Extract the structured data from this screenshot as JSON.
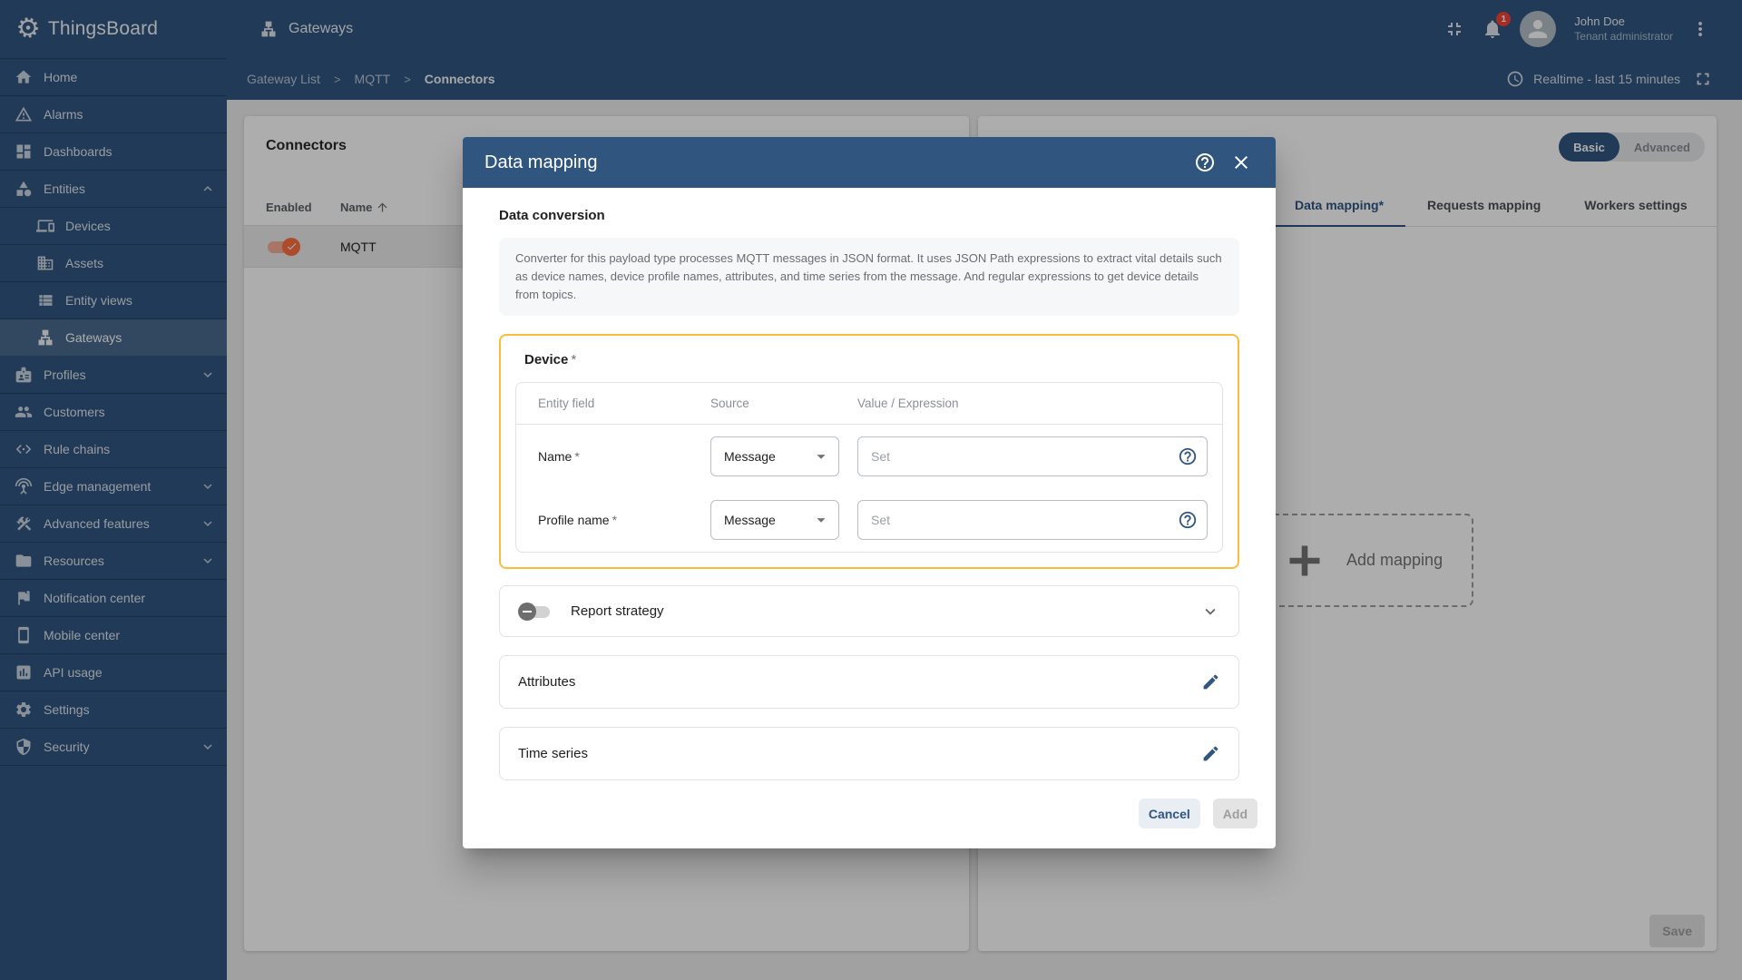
{
  "app": {
    "name": "ThingsBoard"
  },
  "topbar": {
    "title": "Gateways",
    "notifications_badge": "1",
    "user": {
      "name": "John Doe",
      "role": "Tenant administrator"
    }
  },
  "breadcrumb": {
    "items": [
      "Gateway List",
      "MQTT",
      "Connectors"
    ],
    "separator": ">"
  },
  "timewindow": {
    "label": "Realtime - last 15 minutes"
  },
  "sidebar": {
    "items": [
      {
        "label": "Home",
        "icon": "home"
      },
      {
        "label": "Alarms",
        "icon": "alarms"
      },
      {
        "label": "Dashboards",
        "icon": "dashboards"
      },
      {
        "label": "Entities",
        "icon": "entities",
        "expanded": true
      },
      {
        "label": "Devices",
        "icon": "devices",
        "child": true
      },
      {
        "label": "Assets",
        "icon": "assets",
        "child": true
      },
      {
        "label": "Entity views",
        "icon": "entity-views",
        "child": true
      },
      {
        "label": "Gateways",
        "icon": "gateways",
        "child": true,
        "active": true
      },
      {
        "label": "Profiles",
        "icon": "profiles",
        "expandable": true
      },
      {
        "label": "Customers",
        "icon": "customers"
      },
      {
        "label": "Rule chains",
        "icon": "rule-chains"
      },
      {
        "label": "Edge management",
        "icon": "edge",
        "expandable": true
      },
      {
        "label": "Advanced features",
        "icon": "advanced",
        "expandable": true
      },
      {
        "label": "Resources",
        "icon": "resources",
        "expandable": true
      },
      {
        "label": "Notification center",
        "icon": "notification"
      },
      {
        "label": "Mobile center",
        "icon": "mobile"
      },
      {
        "label": "API usage",
        "icon": "api"
      },
      {
        "label": "Settings",
        "icon": "settings"
      },
      {
        "label": "Security",
        "icon": "security",
        "expandable": true
      }
    ]
  },
  "connectors_panel": {
    "title": "Connectors",
    "columns": [
      "Enabled",
      "Name"
    ],
    "rows": [
      {
        "name": "MQTT",
        "enabled": true
      }
    ]
  },
  "connector_detail": {
    "modes": [
      "Basic",
      "Advanced"
    ],
    "active_mode": "Basic",
    "tabs": [
      "Data mapping*",
      "Requests mapping",
      "Workers settings"
    ],
    "active_tab": "Data mapping*",
    "add_mapping_label": "Add mapping",
    "save_label": "Save"
  },
  "modal": {
    "title": "Data mapping",
    "data_conversion": {
      "heading": "Data conversion",
      "description": "Converter for this payload type processes MQTT messages in JSON format. It uses JSON Path expressions to extract vital details such as device names, device profile names, attributes, and time series from the message. And regular expressions to get device details from topics."
    },
    "device": {
      "heading": "Device",
      "required_marker": "*",
      "columns": [
        "Entity field",
        "Source",
        "Value / Expression"
      ],
      "rows": [
        {
          "field": "Name",
          "required": "*",
          "source": "Message",
          "value": "",
          "value_placeholder": "Set"
        },
        {
          "field": "Profile name",
          "required": "*",
          "source": "Message",
          "value": "",
          "value_placeholder": "Set"
        }
      ]
    },
    "report_strategy": {
      "label": "Report strategy",
      "enabled": false
    },
    "attributes": {
      "label": "Attributes"
    },
    "time_series": {
      "label": "Time series"
    },
    "footer": {
      "cancel_label": "Cancel",
      "add_label": "Add"
    }
  },
  "colors": {
    "primary": "#305680",
    "toggle_orange": "#ff7043",
    "highlight_border": "#fbbc3e",
    "badge_red": "#f44336"
  }
}
